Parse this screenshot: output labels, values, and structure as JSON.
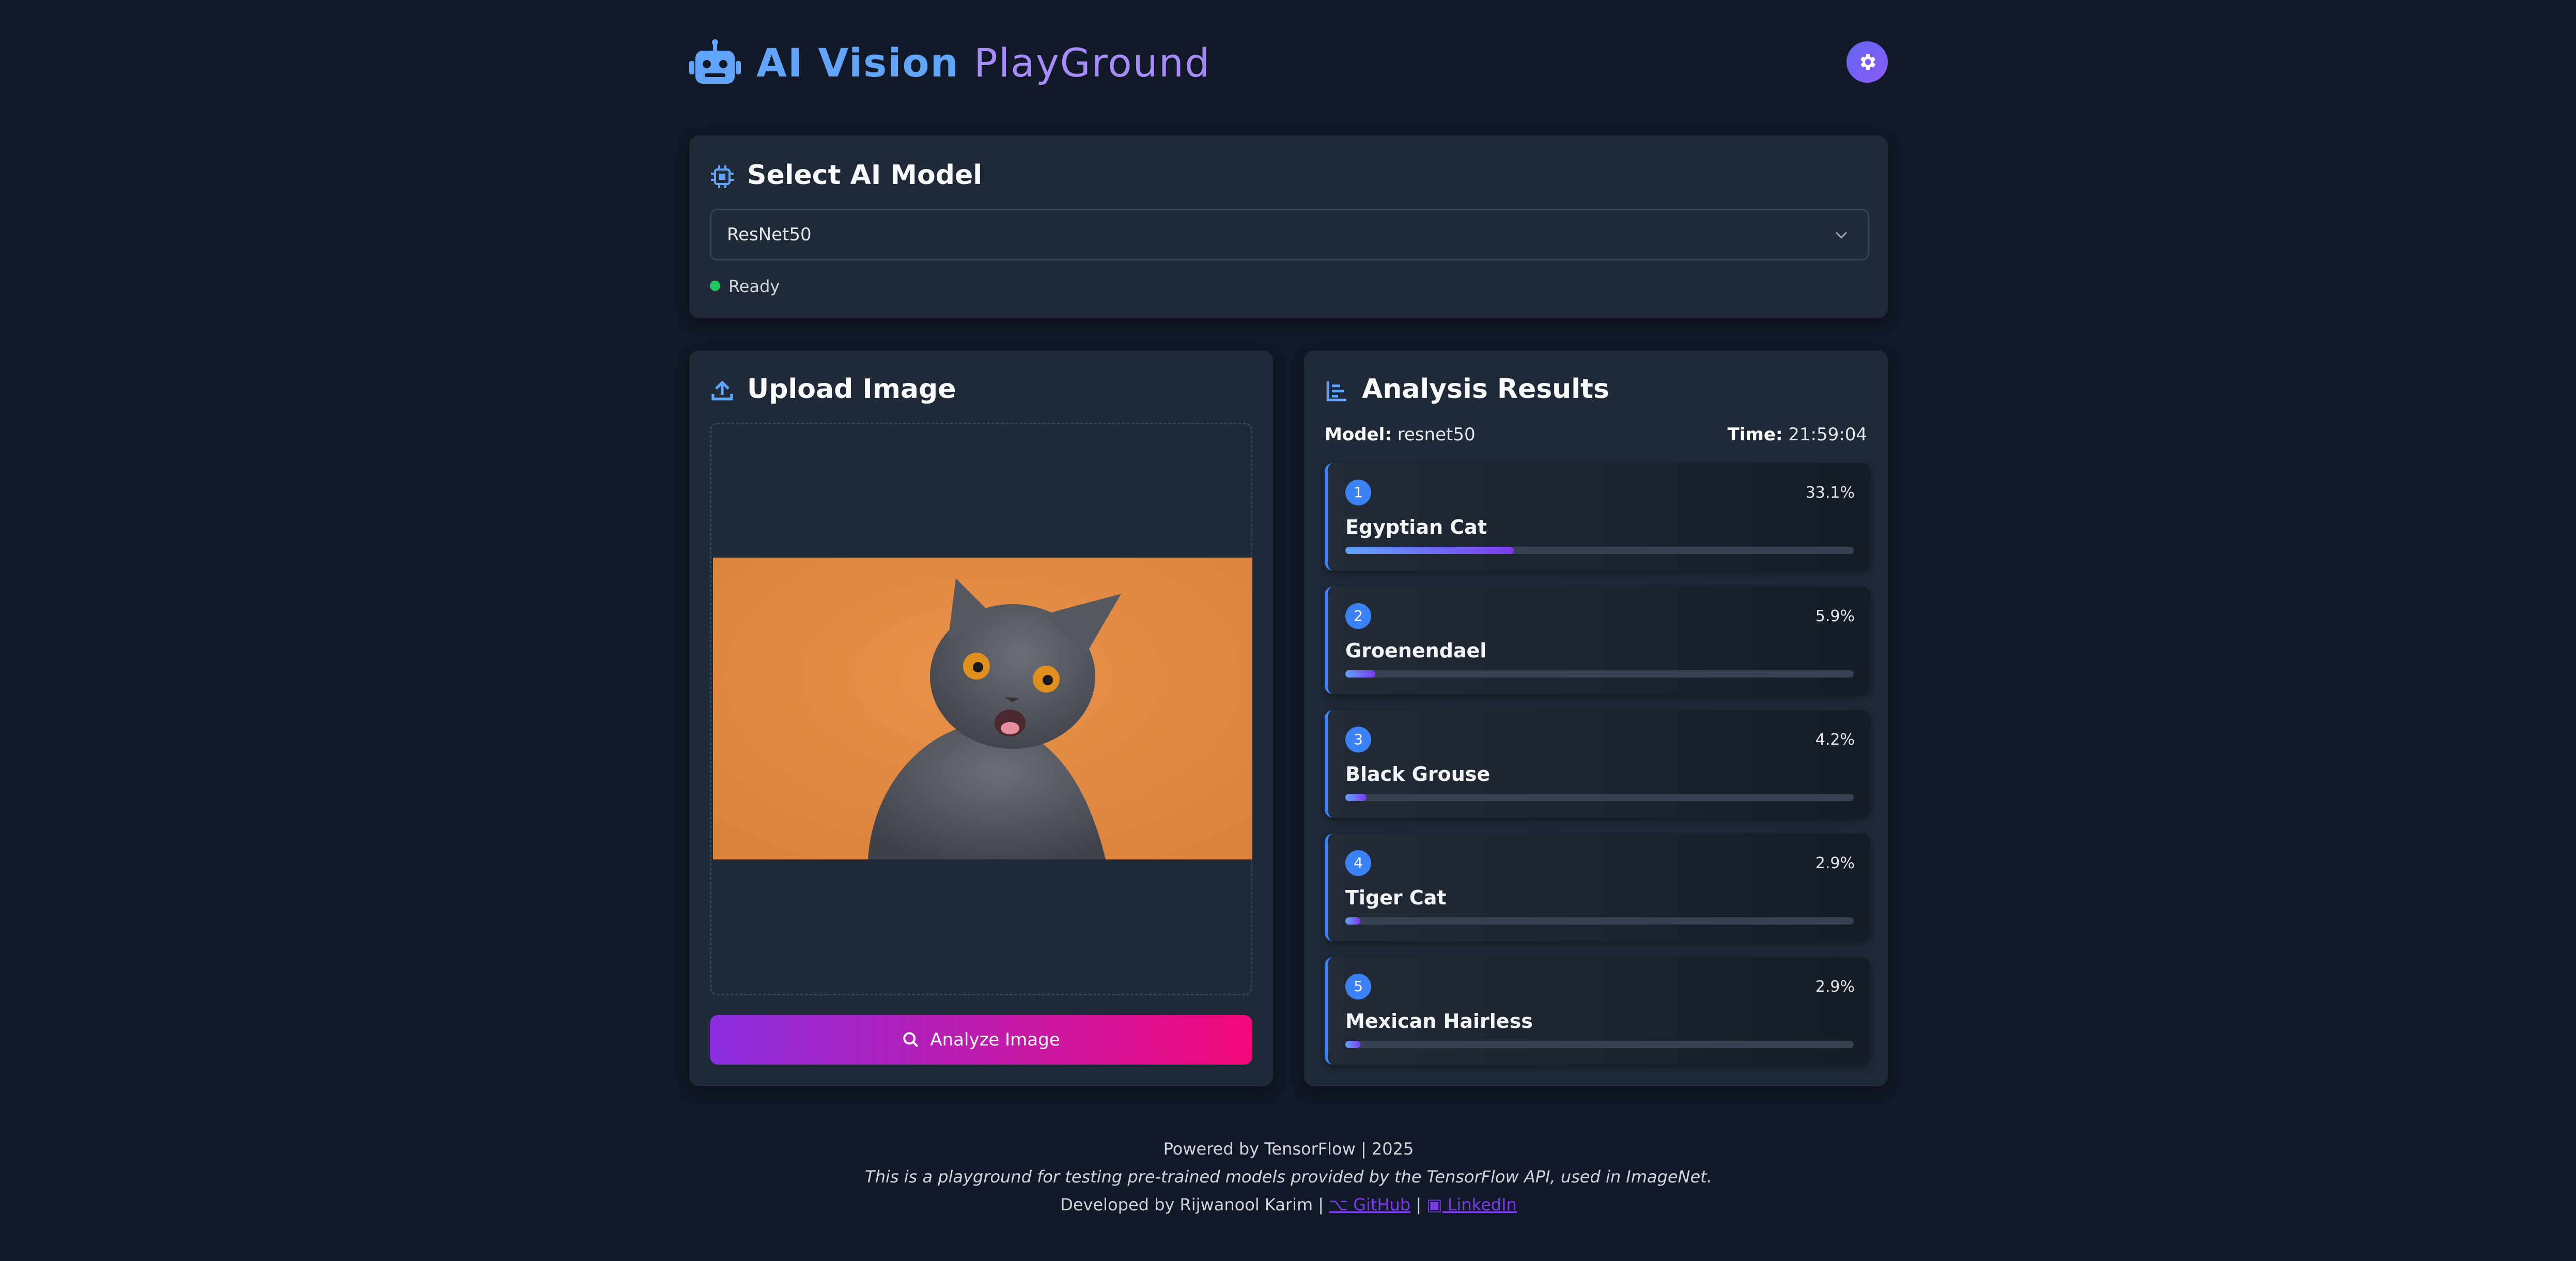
{
  "header": {
    "title_part1": "AI Vision",
    "title_part2": "PlayGround",
    "logo_icon": "robot-icon",
    "settings_icon": "gear-icon"
  },
  "model_section": {
    "title": "Select AI Model",
    "icon": "chip-icon",
    "selected_model": "ResNet50",
    "status": "Ready"
  },
  "upload_section": {
    "title": "Upload Image",
    "icon": "upload-icon",
    "image_subject": "gray cat on orange background",
    "analyze_button": "Analyze Image"
  },
  "results_section": {
    "title": "Analysis Results",
    "icon": "bar-chart-icon",
    "model_label": "Model:",
    "model_value": "resnet50",
    "time_label": "Time:",
    "time_value": "21:59:04",
    "results": [
      {
        "rank": "1",
        "label": "Egyptian Cat",
        "percent": "33.1%",
        "value": 0.331
      },
      {
        "rank": "2",
        "label": "Groenendael",
        "percent": "5.9%",
        "value": 0.059
      },
      {
        "rank": "3",
        "label": "Black Grouse",
        "percent": "4.2%",
        "value": 0.042
      },
      {
        "rank": "4",
        "label": "Tiger Cat",
        "percent": "2.9%",
        "value": 0.029
      },
      {
        "rank": "5",
        "label": "Mexican Hairless",
        "percent": "2.9%",
        "value": 0.029
      }
    ]
  },
  "footer": {
    "powered": "Powered by TensorFlow | 2025",
    "description": "This is a playground for testing pre-trained models provided by the TensorFlow API, used in ImageNet.",
    "developer": "Developed by Rijwanool Karim |",
    "github": "GitHub",
    "separator": "|",
    "linkedin": "LinkedIn"
  },
  "colors": {
    "background": "#111827",
    "card": "#1f2937",
    "accent_blue": "#3b82f6",
    "accent_purple": "#7c3aed",
    "button_gradient_start": "#8b2fe0",
    "button_gradient_end": "#f2087a",
    "status_green": "#22c55e"
  }
}
